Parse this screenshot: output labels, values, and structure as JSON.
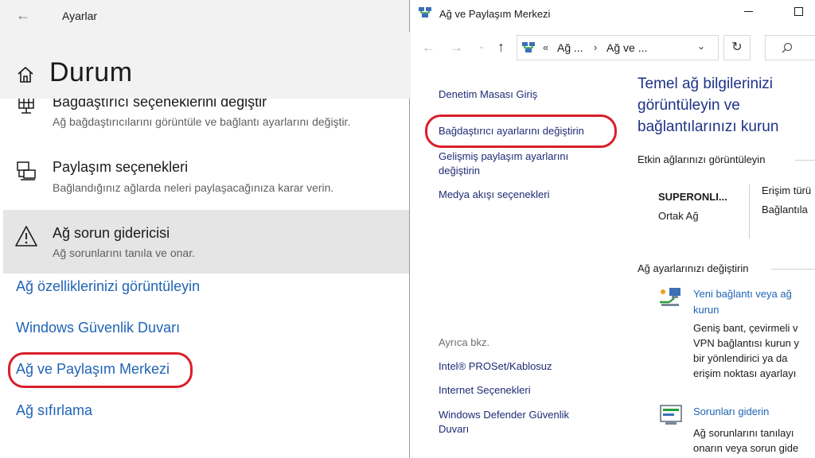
{
  "settings": {
    "app_title": "Ayarlar",
    "page_title": "Durum",
    "items": [
      {
        "title": "Bağdaştırıcı seçeneklerini değiştir",
        "desc": "Ağ bağdaştırıcılarını görüntüle ve bağlantı ayarlarını değiştir."
      },
      {
        "title": "Paylaşım seçenekleri",
        "desc": "Bağlandığınız ağlarda neleri paylaşacağınıza karar verin."
      },
      {
        "title": "Ağ sorun gidericisi",
        "desc": "Ağ sorunlarını tanıla ve onar."
      }
    ],
    "links": [
      "Ağ özelliklerinizi görüntüleyin",
      "Windows Güvenlik Duvarı",
      "Ağ ve Paylaşım Merkezi",
      "Ağ sıfırlama"
    ]
  },
  "control_panel": {
    "window_title": "Ağ ve Paylaşım Merkezi",
    "address": {
      "sep0": "«",
      "crumb1": "Ağ ...",
      "sep1": "›",
      "crumb2": "Ağ ve ..."
    },
    "sidebar": {
      "home": "Denetim Masası Giriş",
      "adapter": "Bağdaştırıcı ayarlarını değiştirin",
      "advanced_1": "Gelişmiş paylaşım ayarlarını",
      "advanced_2": "değiştirin",
      "media": "Medya akışı seçenekleri",
      "see_also": "Ayrıca bkz.",
      "intel": "Intel® PROSet/Kablosuz",
      "internet": "Internet Seçenekleri",
      "defender_1": "Windows Defender Güvenlik",
      "defender_2": "Duvarı"
    },
    "main_title": "Temel ağ bilgilerinizi görüntüleyin ve bağlantılarınızı kurun",
    "active_section": "Etkin ağlarınızı görüntüleyin",
    "network": {
      "name": "SUPERONLI...",
      "type": "Ortak Ağ",
      "access": "Erişim türü",
      "connections": "Bağlantıla"
    },
    "change_section": "Ağ ayarlarınızı değiştirin",
    "tasks": [
      {
        "title_1": "Yeni bağlantı veya ağ",
        "title_2": "kurun",
        "desc": [
          "Geniş bant, çevirmeli v",
          "VPN bağlantısı kurun y",
          "bir yönlendirici ya da",
          "erişim noktası ayarlayı"
        ]
      },
      {
        "title_1": "Sorunları giderin",
        "desc": [
          "Ağ sorunlarını tanılayı",
          "onarın veya sorun gide"
        ]
      }
    ]
  },
  "colors": {
    "link": "#1f64b5",
    "cp_link": "#1e2b74",
    "title_blue": "#1e3287",
    "highlight": "#d8202b",
    "hover": "#e5e5e5"
  },
  "icons": [
    "back-arrow-icon",
    "home-icon",
    "network-adapter-icon",
    "sharing-icon",
    "warning-icon",
    "network-center-icon",
    "up-arrow-icon",
    "refresh-icon",
    "search-icon",
    "new-connection-icon",
    "troubleshoot-icon"
  ]
}
